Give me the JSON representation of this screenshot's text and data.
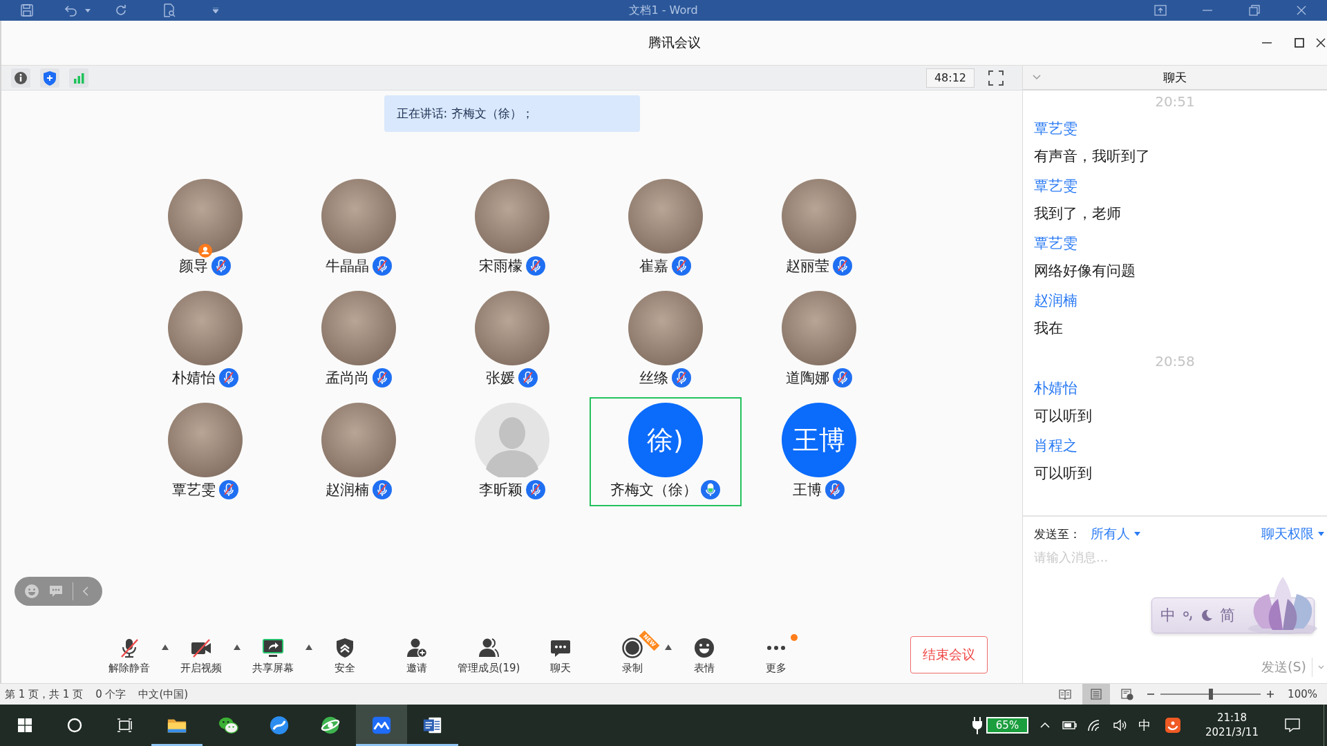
{
  "word_window": {
    "title": "文档1 - Word",
    "status_bar": {
      "page": "第 1 页，共 1 页",
      "words": "0 个字",
      "language": "中文(中国)",
      "views": [
        {
          "selected": false
        },
        {
          "selected": true
        },
        {
          "selected": false
        }
      ],
      "zoom": {
        "level": 0.5,
        "reading": "100%"
      }
    }
  },
  "meeting_window": {
    "title": "腾讯会议",
    "timer": "48:12",
    "speaking_banner": "正在讲话: 齐梅文（徐）；",
    "participants": [
      {
        "name": "颜导",
        "avatar": {
          "kind": "photo"
        },
        "host": true,
        "muted": true,
        "speaking": false
      },
      {
        "name": "牛晶晶",
        "avatar": {
          "kind": "photo"
        },
        "host": false,
        "muted": true,
        "speaking": false
      },
      {
        "name": "宋雨檬",
        "avatar": {
          "kind": "photo"
        },
        "host": false,
        "muted": true,
        "speaking": false
      },
      {
        "name": "崔嘉",
        "avatar": {
          "kind": "photo"
        },
        "host": false,
        "muted": true,
        "speaking": false
      },
      {
        "name": "赵丽莹",
        "avatar": {
          "kind": "photo"
        },
        "host": false,
        "muted": true,
        "speaking": false
      },
      {
        "name": "朴婧怡",
        "avatar": {
          "kind": "photo"
        },
        "host": false,
        "muted": true,
        "speaking": false
      },
      {
        "name": "孟尚尚",
        "avatar": {
          "kind": "photo"
        },
        "host": false,
        "muted": true,
        "speaking": false
      },
      {
        "name": "张媛",
        "avatar": {
          "kind": "photo"
        },
        "host": false,
        "muted": true,
        "speaking": false
      },
      {
        "name": "丝绦",
        "avatar": {
          "kind": "photo"
        },
        "host": false,
        "muted": true,
        "speaking": false
      },
      {
        "name": "道陶娜",
        "avatar": {
          "kind": "photo"
        },
        "host": false,
        "muted": true,
        "speaking": false
      },
      {
        "name": "覃艺雯",
        "avatar": {
          "kind": "photo"
        },
        "host": false,
        "muted": true,
        "speaking": false
      },
      {
        "name": "赵润楠",
        "avatar": {
          "kind": "photo"
        },
        "host": false,
        "muted": true,
        "speaking": false
      },
      {
        "name": "李昕颖",
        "avatar": {
          "kind": "silhouette"
        },
        "host": false,
        "muted": true,
        "speaking": false
      },
      {
        "name": "齐梅文（徐）",
        "avatar": {
          "kind": "initials",
          "initials": "徐)"
        },
        "host": false,
        "muted": false,
        "speaking": true
      },
      {
        "name": "王博",
        "avatar": {
          "kind": "initials",
          "initials": "王博"
        },
        "host": false,
        "muted": true,
        "speaking": false
      }
    ],
    "toolbar": [
      {
        "label": "解除静音",
        "off": true,
        "menu": true,
        "dot": false
      },
      {
        "label": "开启视频",
        "off": true,
        "menu": true,
        "dot": false
      },
      {
        "label": "共享屏幕",
        "off": false,
        "menu": true,
        "dot": false
      },
      {
        "label": "安全",
        "off": false,
        "menu": false,
        "dot": false
      },
      {
        "label": "邀请",
        "off": false,
        "menu": false,
        "dot": false
      },
      {
        "label": "管理成员(19)",
        "off": false,
        "menu": false,
        "dot": false
      },
      {
        "label": "聊天",
        "off": false,
        "menu": false,
        "dot": false
      },
      {
        "label": "录制",
        "off": false,
        "menu": true,
        "dot": false,
        "badge": "NEW"
      },
      {
        "label": "表情",
        "off": false,
        "menu": false,
        "dot": false
      },
      {
        "label": "更多",
        "off": false,
        "menu": false,
        "dot": true
      }
    ],
    "end_button": "结束会议",
    "chat": {
      "title": "聊天",
      "messages": [
        {
          "kind": "time",
          "text": "20:51"
        },
        {
          "kind": "message",
          "sender": "覃艺雯",
          "text": "有声音，我听到了"
        },
        {
          "kind": "message",
          "sender": "覃艺雯",
          "text": "我到了，老师"
        },
        {
          "kind": "message",
          "sender": "覃艺雯",
          "text": "网络好像有问题"
        },
        {
          "kind": "message",
          "sender": "赵润楠",
          "text": "我在"
        },
        {
          "kind": "time",
          "text": "20:58"
        },
        {
          "kind": "message",
          "sender": "朴婧怡",
          "text": "可以听到"
        },
        {
          "kind": "message",
          "sender": "肖程之",
          "text": "可以听到"
        }
      ],
      "send_to_label": "发送至：",
      "recipient": "所有人",
      "permissions": "聊天权限",
      "placeholder": "请输入消息...",
      "send_button": "发送(S)"
    }
  },
  "ime_bar": {
    "mode": "中",
    "script": "简"
  },
  "taskbar": {
    "apps": [
      {
        "running": true,
        "selected": false
      },
      {
        "running": false,
        "selected": false
      },
      {
        "running": false,
        "selected": false
      },
      {
        "running": false,
        "selected": false
      },
      {
        "running": true,
        "selected": true
      },
      {
        "running": true,
        "selected": false
      }
    ],
    "battery": "65%",
    "input_language": "中",
    "time": "21:18",
    "date": "2021/3/11"
  }
}
